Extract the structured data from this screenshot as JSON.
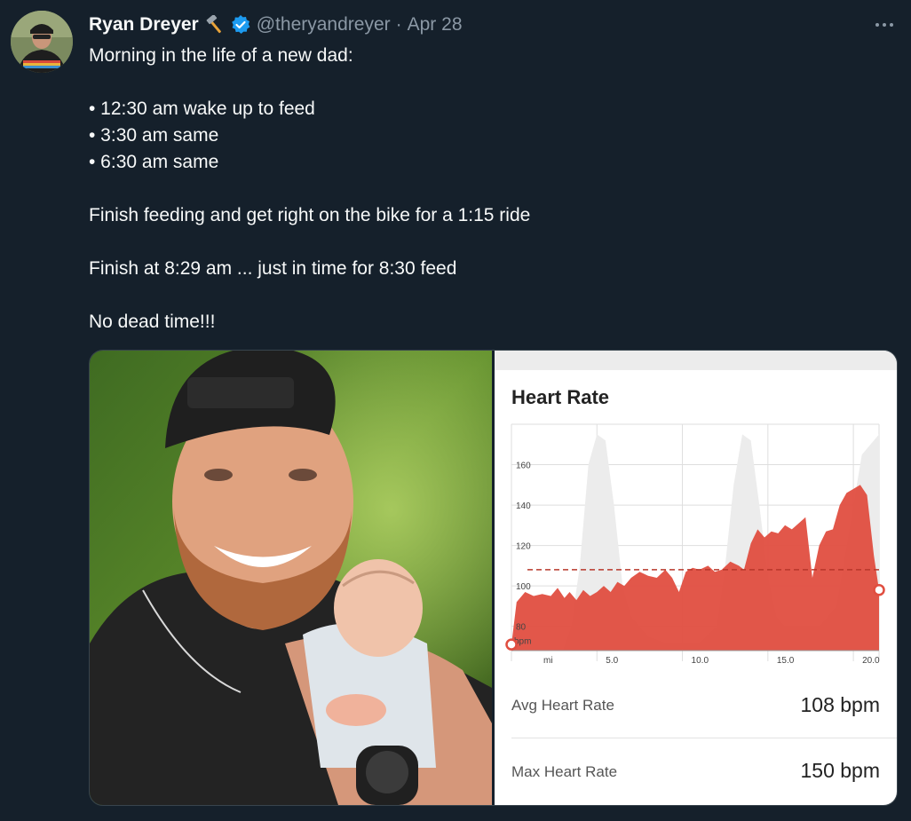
{
  "tweet": {
    "author_name": "Ryan Dreyer",
    "author_emoji": "hammer-axe-emoji",
    "verified_icon": "verified-badge-icon",
    "handle": "@theryandreyer",
    "separator": "·",
    "date": "Apr 28",
    "more_icon": "more-options-icon",
    "lines": [
      "Morning in the life of a new dad:",
      "",
      "• 12:30 am wake up to feed",
      "• 3:30 am same",
      "• 6:30 am same",
      "",
      "Finish feeding and get right on the bike for a 1:15 ride",
      "",
      "Finish at 8:29 am ... just in time for 8:30 feed",
      "",
      "No dead time!!!"
    ]
  },
  "heart_rate_panel": {
    "title": "Heart Rate",
    "avg_label": "Avg Heart Rate",
    "avg_value": "108 bpm",
    "max_label": "Max Heart Rate",
    "max_value": "150 bpm"
  },
  "chart_data": {
    "type": "area",
    "title": "Heart Rate",
    "xlabel": "mi",
    "ylabel": "bpm",
    "x_ticks": [
      "5.0",
      "10.0",
      "15.0",
      "20.0"
    ],
    "y_ticks": [
      "80",
      "100",
      "120",
      "140",
      "160"
    ],
    "xlim": [
      0,
      21.5
    ],
    "ylim": [
      68,
      180
    ],
    "average": 108,
    "series": [
      {
        "color": "#e04e40",
        "x": [
          0,
          0.3,
          0.8,
          1.3,
          1.8,
          2.3,
          2.7,
          3.1,
          3.4,
          3.8,
          4.2,
          4.6,
          5.0,
          5.4,
          5.8,
          6.2,
          6.6,
          7.0,
          7.5,
          8.0,
          8.5,
          9.0,
          9.4,
          9.8,
          10.2,
          10.6,
          11.0,
          11.5,
          11.9,
          12.3,
          12.8,
          13.3,
          13.6,
          14.0,
          14.4,
          14.8,
          15.2,
          15.6,
          16.0,
          16.4,
          16.8,
          17.2,
          17.6,
          18.0,
          18.4,
          18.8,
          19.2,
          19.6,
          20.0,
          20.4,
          20.8,
          21.2,
          21.5
        ],
        "values": [
          71,
          92,
          97,
          95,
          96,
          95,
          99,
          94,
          97,
          93,
          98,
          95,
          97,
          100,
          97,
          102,
          100,
          104,
          107,
          105,
          104,
          108,
          104,
          97,
          107,
          109,
          108,
          110,
          107,
          108,
          112,
          110,
          108,
          121,
          128,
          124,
          127,
          126,
          130,
          128,
          131,
          134,
          104,
          120,
          127,
          128,
          140,
          146,
          148,
          150,
          145,
          115,
          98
        ]
      },
      {
        "color": "#ececec",
        "x": [
          0,
          1,
          2,
          3,
          3.5,
          4,
          4.5,
          5,
          5.5,
          6,
          6.5,
          7,
          7.5,
          8,
          9,
          10,
          11,
          12,
          12.5,
          13,
          13.5,
          14,
          14.5,
          15,
          15.5,
          16,
          17,
          18,
          19,
          20,
          20.5,
          21,
          21.5
        ],
        "values": [
          68,
          68,
          68,
          68,
          80,
          110,
          160,
          175,
          172,
          140,
          100,
          85,
          80,
          75,
          72,
          72,
          72,
          80,
          110,
          150,
          175,
          172,
          140,
          105,
          85,
          80,
          80,
          80,
          90,
          140,
          165,
          170,
          175
        ]
      }
    ]
  }
}
